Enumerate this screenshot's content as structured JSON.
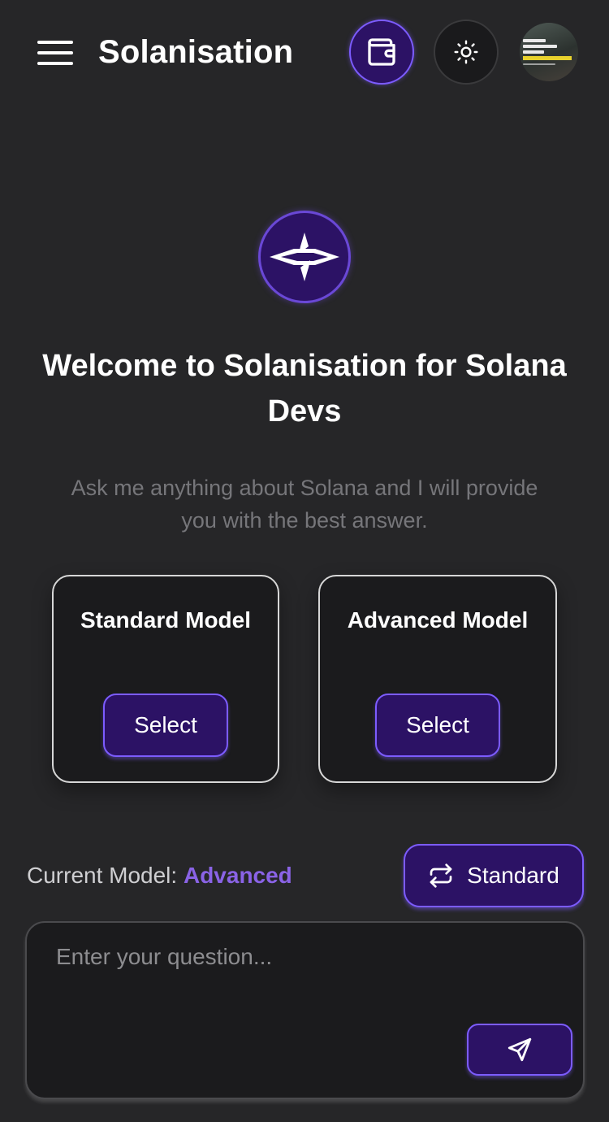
{
  "header": {
    "title": "Solanisation",
    "menu_icon": "hamburger-menu-icon",
    "wallet_icon": "wallet-icon",
    "theme_icon": "sun-icon",
    "avatar": "user-avatar",
    "avatar_text": [
      "FIGHT FOR",
      "YOUR DREAMS",
      "AND YOUR",
      "DREAMS WILL FIGHT FOR YOU"
    ]
  },
  "hero": {
    "logo_icon": "solanisation-logo-icon",
    "welcome": "Welcome to Solanisation for Solana Devs",
    "subtitle": "Ask me anything about Solana and I will provide you with the best answer."
  },
  "models": [
    {
      "title": "Standard Model",
      "button": "Select"
    },
    {
      "title": "Advanced Model",
      "button": "Select"
    }
  ],
  "current_model": {
    "label": "Current Model:",
    "value": "Advanced",
    "switch_label": "Standard",
    "switch_icon": "swap-arrows-icon"
  },
  "question": {
    "placeholder": "Enter your question...",
    "send_icon": "send-icon"
  },
  "colors": {
    "background": "#262628",
    "accent": "#2c1265",
    "accent_border": "#7c5cff",
    "highlight_text": "#8a63e6",
    "card_bg": "#1b1b1d"
  }
}
